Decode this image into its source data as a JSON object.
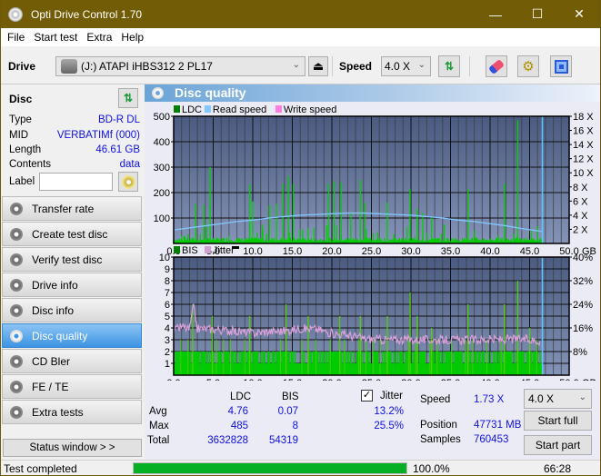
{
  "window": {
    "title": "Opti Drive Control 1.70",
    "minimize": "—",
    "maximize": "☐",
    "close": "✕"
  },
  "menu": [
    "File",
    "Start test",
    "Extra",
    "Help"
  ],
  "toolbar": {
    "drive_label": "Drive",
    "drive_value": "(J:)  ATAPI iHBS312   2 PL17",
    "speed_label": "Speed",
    "speed_value": "4.0 X",
    "icons": [
      "eject-icon",
      "refresh-icon",
      "erase-icon",
      "settings-icon",
      "save-icon"
    ]
  },
  "disc": {
    "header": "Disc",
    "rows": [
      {
        "k": "Type",
        "v": "BD-R DL"
      },
      {
        "k": "MID",
        "v": "VERBATIMf (000)"
      },
      {
        "k": "Length",
        "v": "46.61 GB"
      },
      {
        "k": "Contents",
        "v": "data"
      }
    ],
    "label_label": "Label",
    "label_value": ""
  },
  "nav": [
    {
      "label": "Transfer rate",
      "active": false
    },
    {
      "label": "Create test disc",
      "active": false
    },
    {
      "label": "Verify test disc",
      "active": false
    },
    {
      "label": "Drive info",
      "active": false
    },
    {
      "label": "Disc info",
      "active": false
    },
    {
      "label": "Disc quality",
      "active": true
    },
    {
      "label": "CD Bler",
      "active": false
    },
    {
      "label": "FE / TE",
      "active": false
    },
    {
      "label": "Extra tests",
      "active": false
    }
  ],
  "status_window_button": "Status window > >",
  "panel": {
    "title": "Disc quality"
  },
  "chart_data": [
    {
      "type": "bar",
      "title": "",
      "legend": [
        "LDC",
        "Read speed",
        "Write speed"
      ],
      "legend_colors": [
        "#008000",
        "#80c8ff",
        "#ff80e0"
      ],
      "xlabel": "GB",
      "x_ticks": [
        "0.0",
        "5.0",
        "10.0",
        "15.0",
        "20.0",
        "25.0",
        "30.0",
        "35.0",
        "40.0",
        "45.0",
        "50.0"
      ],
      "y_ticks_left": [
        "100",
        "200",
        "300",
        "400",
        "500"
      ],
      "y_ticks_right": [
        "2 X",
        "4 X",
        "6 X",
        "8 X",
        "10 X",
        "12 X",
        "14 X",
        "16 X",
        "18 X"
      ],
      "xlim": [
        0,
        50
      ],
      "ylim": [
        0,
        500
      ],
      "y2lim": [
        0,
        18
      ],
      "disc_end_gb": 46.61,
      "ldc_peaks": [
        [
          1.0,
          30
        ],
        [
          2.8,
          155
        ],
        [
          3.8,
          150
        ],
        [
          4.6,
          300
        ],
        [
          7.0,
          30
        ],
        [
          9.6,
          232
        ],
        [
          10.0,
          165
        ],
        [
          11.2,
          75
        ],
        [
          12.1,
          150
        ],
        [
          13.0,
          155
        ],
        [
          13.8,
          235
        ],
        [
          14.5,
          265
        ],
        [
          15.1,
          235
        ],
        [
          16.3,
          55
        ],
        [
          17.0,
          60
        ],
        [
          19.6,
          235
        ],
        [
          20.3,
          245
        ],
        [
          20.6,
          70
        ],
        [
          21.2,
          240
        ],
        [
          22.4,
          120
        ],
        [
          23.6,
          250
        ],
        [
          24.2,
          160
        ],
        [
          25.2,
          40
        ],
        [
          27.0,
          160
        ],
        [
          29.9,
          215
        ],
        [
          30.8,
          135
        ],
        [
          31.5,
          120
        ],
        [
          32.6,
          105
        ],
        [
          34.2,
          75
        ],
        [
          37.2,
          215
        ],
        [
          41.8,
          235
        ],
        [
          43.5,
          485
        ],
        [
          45.2,
          50
        ],
        [
          46.4,
          20
        ]
      ],
      "ldc_baseline": 18,
      "read_speed_x": [
        [
          0,
          1.9
        ],
        [
          2,
          2.2
        ],
        [
          4,
          2.5
        ],
        [
          6,
          2.8
        ],
        [
          8,
          3.1
        ],
        [
          10,
          3.3
        ],
        [
          12,
          3.6
        ],
        [
          14,
          3.8
        ],
        [
          16,
          4.0
        ],
        [
          18,
          4.1
        ],
        [
          20,
          4.2
        ],
        [
          22,
          4.3
        ],
        [
          24,
          4.3
        ],
        [
          26,
          4.2
        ],
        [
          28,
          4.1
        ],
        [
          30,
          4.0
        ],
        [
          32,
          3.8
        ],
        [
          34,
          3.6
        ],
        [
          36,
          3.3
        ],
        [
          38,
          3.1
        ],
        [
          40,
          2.8
        ],
        [
          42,
          2.5
        ],
        [
          44,
          2.1
        ],
        [
          46.6,
          1.7
        ]
      ]
    },
    {
      "type": "bar",
      "title": "",
      "legend": [
        "BIS",
        "Jitter"
      ],
      "legend_colors": [
        "#008000",
        "#d0a0d0"
      ],
      "xlabel": "GB",
      "x_ticks": [
        "0.0",
        "5.0",
        "10.0",
        "15.0",
        "20.0",
        "25.0",
        "30.0",
        "35.0",
        "40.0",
        "45.0",
        "50.0"
      ],
      "y_ticks_left": [
        "1",
        "2",
        "3",
        "4",
        "5",
        "6",
        "7",
        "8",
        "9",
        "10"
      ],
      "y_ticks_right": [
        "8%",
        "16%",
        "24%",
        "32%",
        "40%"
      ],
      "xlim": [
        0,
        50
      ],
      "ylim": [
        0,
        10
      ],
      "y2lim": [
        0,
        40
      ],
      "disc_end_gb": 46.61,
      "bis_peaks": [
        [
          2.4,
          6
        ],
        [
          4.9,
          5
        ],
        [
          9.6,
          5
        ],
        [
          14.2,
          6
        ],
        [
          17.0,
          5
        ],
        [
          21.0,
          5
        ],
        [
          23.6,
          5
        ],
        [
          27.0,
          5
        ],
        [
          29.9,
          7
        ],
        [
          30.8,
          5
        ],
        [
          32.6,
          4
        ],
        [
          37.2,
          6
        ],
        [
          41.8,
          6
        ],
        [
          43.5,
          8
        ],
        [
          45.0,
          4
        ]
      ],
      "bis_baseline": 2,
      "jitter_pct": [
        [
          0,
          14.8
        ],
        [
          1,
          16.5
        ],
        [
          2,
          15.5
        ],
        [
          2.5,
          23
        ],
        [
          3,
          15.8
        ],
        [
          5,
          15.6
        ],
        [
          8,
          14.8
        ],
        [
          10,
          14.3
        ],
        [
          12,
          14.8
        ],
        [
          14,
          15.0
        ],
        [
          16,
          15.8
        ],
        [
          18,
          15.6
        ],
        [
          20,
          14.2
        ],
        [
          22,
          13.6
        ],
        [
          24,
          12.4
        ],
        [
          26,
          12.0
        ],
        [
          30,
          12.0
        ],
        [
          35,
          11.9
        ],
        [
          40,
          12.0
        ],
        [
          44,
          12.2
        ],
        [
          46.4,
          11.5
        ]
      ]
    }
  ],
  "stats": {
    "col_ldc": "LDC",
    "col_bis": "BIS",
    "jitter_label": "Jitter",
    "jitter_checked": true,
    "rows": [
      {
        "k": "Avg",
        "ldc": "4.76",
        "bis": "0.07",
        "jit": "13.2%"
      },
      {
        "k": "Max",
        "ldc": "485",
        "bis": "8",
        "jit": "25.5%"
      },
      {
        "k": "Total",
        "ldc": "3632828",
        "bis": "54319",
        "jit": ""
      }
    ],
    "speed_label": "Speed",
    "speed_value": "1.73 X",
    "position_label": "Position",
    "position_value": "47731 MB",
    "samples_label": "Samples",
    "samples_value": "760453",
    "speed_select": "4.0 X",
    "start_full": "Start full",
    "start_part": "Start part"
  },
  "status": {
    "text": "Test completed",
    "progress": 1.0,
    "progress_text": "100.0%",
    "time": "66:28"
  }
}
